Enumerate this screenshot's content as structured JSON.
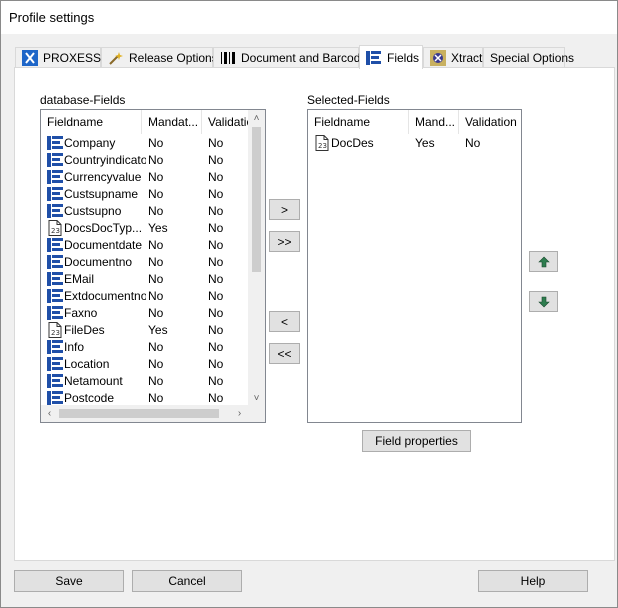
{
  "window": {
    "title": "Profile settings"
  },
  "tabs": [
    {
      "label": "PROXESS",
      "icon": "proxess-x-icon"
    },
    {
      "label": "Release Options",
      "icon": "magic-wand-icon"
    },
    {
      "label": "Document and Barcode",
      "icon": "barcode-icon"
    },
    {
      "label": "Fields",
      "icon": "fields-list-icon",
      "active": true
    },
    {
      "label": "Xtract",
      "icon": "xtract-icon"
    },
    {
      "label": "Special Options",
      "icon": ""
    }
  ],
  "database_fields": {
    "label": "database-Fields",
    "columns": [
      "Fieldname",
      "Mandat...",
      "Validatio"
    ],
    "rows": [
      {
        "name": "Company",
        "mandatory": "No",
        "validation": "No",
        "icon": "list-field-icon"
      },
      {
        "name": "Countryindicator",
        "mandatory": "No",
        "validation": "No",
        "icon": "list-field-icon"
      },
      {
        "name": "Currencyvalue",
        "mandatory": "No",
        "validation": "No",
        "icon": "list-field-icon"
      },
      {
        "name": "Custsupname",
        "mandatory": "No",
        "validation": "No",
        "icon": "list-field-icon"
      },
      {
        "name": "Custsupno",
        "mandatory": "No",
        "validation": "No",
        "icon": "list-field-icon"
      },
      {
        "name": "DocsDocTyp...",
        "mandatory": "Yes",
        "validation": "No",
        "icon": "document-field-icon"
      },
      {
        "name": "Documentdate",
        "mandatory": "No",
        "validation": "No",
        "icon": "list-field-icon"
      },
      {
        "name": "Documentno",
        "mandatory": "No",
        "validation": "No",
        "icon": "list-field-icon"
      },
      {
        "name": "EMail",
        "mandatory": "No",
        "validation": "No",
        "icon": "list-field-icon"
      },
      {
        "name": "Extdocumentno",
        "mandatory": "No",
        "validation": "No",
        "icon": "list-field-icon"
      },
      {
        "name": "Faxno",
        "mandatory": "No",
        "validation": "No",
        "icon": "list-field-icon"
      },
      {
        "name": "FileDes",
        "mandatory": "Yes",
        "validation": "No",
        "icon": "document-field-icon"
      },
      {
        "name": "Info",
        "mandatory": "No",
        "validation": "No",
        "icon": "list-field-icon"
      },
      {
        "name": "Location",
        "mandatory": "No",
        "validation": "No",
        "icon": "list-field-icon"
      },
      {
        "name": "Netamount",
        "mandatory": "No",
        "validation": "No",
        "icon": "list-field-icon"
      },
      {
        "name": "Postcode",
        "mandatory": "No",
        "validation": "No",
        "icon": "list-field-icon"
      }
    ]
  },
  "selected_fields": {
    "label": "Selected-Fields",
    "columns": [
      "Fieldname",
      "Mand...",
      "Validation"
    ],
    "rows": [
      {
        "name": "DocDes",
        "mandatory": "Yes",
        "validation": "No",
        "icon": "document-field-icon"
      }
    ]
  },
  "transfer_buttons": {
    "add": ">",
    "add_all": ">>",
    "remove": "<",
    "remove_all": "<<"
  },
  "field_properties_label": "Field properties",
  "footer": {
    "save": "Save",
    "cancel": "Cancel",
    "help": "Help"
  },
  "colors": {
    "field_icon_blue": "#1f4fa8",
    "move_arrow_green": "#2e7d4f",
    "button_face": "#e1e1e1",
    "button_border": "#adadad"
  }
}
